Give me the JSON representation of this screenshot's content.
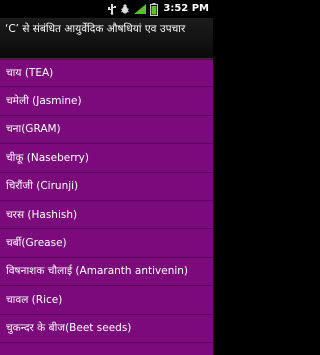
{
  "status_bar": {
    "time": "3:52 PM",
    "icons": [
      "usb-icon",
      "usb-debug-icon",
      "signal-icon",
      "battery-icon"
    ]
  },
  "header": {
    "title": "‘C’ से संबंधित आयुर्वेदिक औषधियां एव उपचार"
  },
  "list": {
    "items": [
      {
        "label": "चाय (TEA)"
      },
      {
        "label": "चमेली (Jasmine)"
      },
      {
        "label": "चना(GRAM)"
      },
      {
        "label": "चीकू (Naseberry)"
      },
      {
        "label": "चिरौंजी (Cirunji)"
      },
      {
        "label": "चरस (Hashish)"
      },
      {
        "label": "चर्बी(Grease)"
      },
      {
        "label": "विषनाशक चौलाई (Amaranth antivenin)"
      },
      {
        "label": "चावल (Rice)"
      },
      {
        "label": "चुकन्दर के बीज(Beet seeds)"
      }
    ]
  },
  "colors": {
    "list_background": "#7b0b7b",
    "title_background": "#1c1c1c",
    "text": "#ffffff"
  }
}
